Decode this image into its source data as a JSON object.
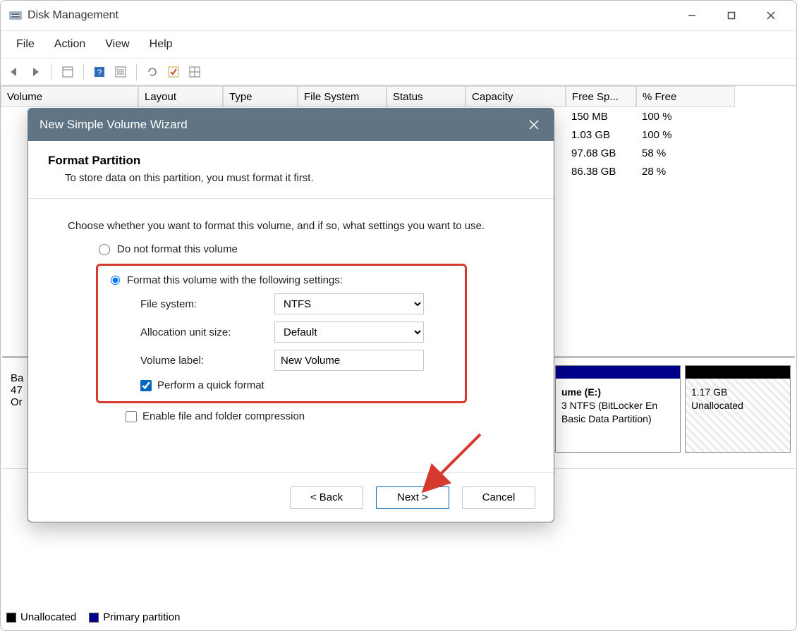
{
  "window": {
    "title": "Disk Management"
  },
  "menubar": [
    "File",
    "Action",
    "View",
    "Help"
  ],
  "table": {
    "headers": [
      "Volume",
      "Layout",
      "Type",
      "File System",
      "Status",
      "Capacity",
      "Free Sp...",
      "% Free"
    ],
    "rows": [
      {
        "free": "150 MB",
        "pct": "100 %"
      },
      {
        "free": "1.03 GB",
        "pct": "100 %"
      },
      {
        "free": "97.68 GB",
        "pct": "58 %"
      },
      {
        "free": "86.38 GB",
        "pct": "28 %"
      }
    ]
  },
  "disk": {
    "info_lines": [
      "Ba",
      "47",
      "Or"
    ],
    "part_e": {
      "title": "ume  (E:)",
      "line1": "3 NTFS (BitLocker En",
      "line2": "Basic Data Partition)"
    },
    "part_unalloc": {
      "line1": "1.17 GB",
      "line2": "Unallocated"
    }
  },
  "legend": {
    "unallocated": "Unallocated",
    "primary": "Primary partition"
  },
  "dialog": {
    "title": "New Simple Volume Wizard",
    "heading": "Format Partition",
    "sub": "To store data on this partition, you must format it first.",
    "instruction": "Choose whether you want to format this volume, and if so, what settings you want to use.",
    "opt_noformat": "Do not format this volume",
    "opt_format": "Format this volume with the following settings:",
    "labels": {
      "fs": "File system:",
      "alloc": "Allocation unit size:",
      "label": "Volume label:"
    },
    "values": {
      "fs": "NTFS",
      "alloc": "Default",
      "label": "New Volume"
    },
    "chk_quick": "Perform a quick format",
    "chk_compress": "Enable file and folder compression",
    "buttons": {
      "back": "< Back",
      "next": "Next >",
      "cancel": "Cancel"
    }
  }
}
